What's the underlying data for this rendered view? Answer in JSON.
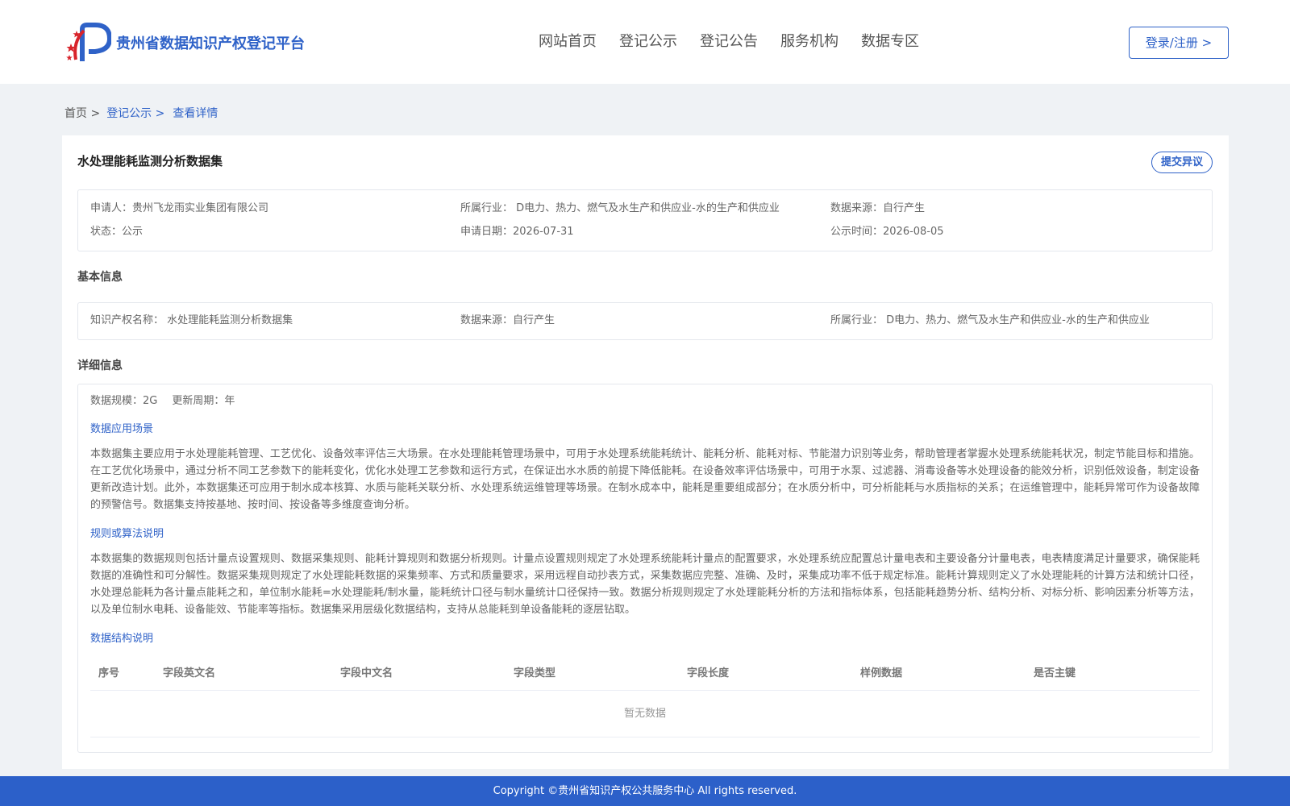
{
  "header": {
    "site_title": "贵州省数据知识产权登记平台",
    "logo_icon": "red-stars-blue-p-logo-icon",
    "nav": [
      "网站首页",
      "登记公示",
      "登记公告",
      "服务机构",
      "数据专区"
    ],
    "login_label": "登录/注册 >"
  },
  "breadcrumb": {
    "home": "首页 >",
    "section": "登记公示 >",
    "current": "查看详情"
  },
  "detail": {
    "title": "水处理能耗监测分析数据集",
    "dispute_label": "提交异议",
    "summary": {
      "applicant": "申请人：贵州飞龙雨实业集团有限公司",
      "industry": "所属行业： D电力、热力、燃气及水生产和供应业-水的生产和供应业",
      "source": "数据来源：自行产生",
      "status": "状态：公示",
      "apply_date": "申请日期：2026-07-31",
      "publish_date": "公示时间：2026-08-05"
    },
    "basic": {
      "section_title": "基本信息",
      "ip_name": "知识产权名称： 水处理能耗监测分析数据集",
      "source": "数据来源：自行产生",
      "industry": "所属行业： D电力、热力、燃气及水生产和供应业-水的生产和供应业"
    },
    "details": {
      "section_title": "详细信息",
      "scale": "数据规模：2G",
      "update_cycle": "更新周期：年",
      "scenario_title": "数据应用场景",
      "scenario_text": "本数据集主要应用于水处理能耗管理、工艺优化、设备效率评估三大场景。在水处理能耗管理场景中，可用于水处理系统能耗统计、能耗分析、能耗对标、节能潜力识别等业务，帮助管理者掌握水处理系统能耗状况，制定节能目标和措施。在工艺优化场景中，通过分析不同工艺参数下的能耗变化，优化水处理工艺参数和运行方式，在保证出水水质的前提下降低能耗。在设备效率评估场景中，可用于水泵、过滤器、消毒设备等水处理设备的能效分析，识别低效设备，制定设备更新改造计划。此外，本数据集还可应用于制水成本核算、水质与能耗关联分析、水处理系统运维管理等场景。在制水成本中，能耗是重要组成部分；在水质分析中，可分析能耗与水质指标的关系；在运维管理中，能耗异常可作为设备故障的预警信号。数据集支持按基地、按时间、按设备等多维度查询分析。",
      "rules_title": "规则或算法说明",
      "rules_text": "本数据集的数据规则包括计量点设置规则、数据采集规则、能耗计算规则和数据分析规则。计量点设置规则规定了水处理系统能耗计量点的配置要求，水处理系统应配置总计量电表和主要设备分计量电表，电表精度满足计量要求，确保能耗数据的准确性和可分解性。数据采集规则规定了水处理能耗数据的采集频率、方式和质量要求，采用远程自动抄表方式，采集数据应完整、准确、及时，采集成功率不低于规定标准。能耗计算规则定义了水处理能耗的计算方法和统计口径，水处理总能耗为各计量点能耗之和，单位制水能耗=水处理能耗/制水量，能耗统计口径与制水量统计口径保持一致。数据分析规则规定了水处理能耗分析的方法和指标体系，包括能耗趋势分析、结构分析、对标分析、影响因素分析等方法，以及单位制水电耗、设备能效、节能率等指标。数据集采用层级化数据结构，支持从总能耗到单设备能耗的逐层钻取。",
      "structure_title": "数据结构说明",
      "table_headers": [
        "序号",
        "字段英文名",
        "字段中文名",
        "字段类型",
        "字段长度",
        "样例数据",
        "是否主键"
      ],
      "empty_text": "暂无数据"
    }
  },
  "footer": {
    "copyright": "Copyright ©贵州省知识产权公共服务中心 All rights reserved."
  }
}
